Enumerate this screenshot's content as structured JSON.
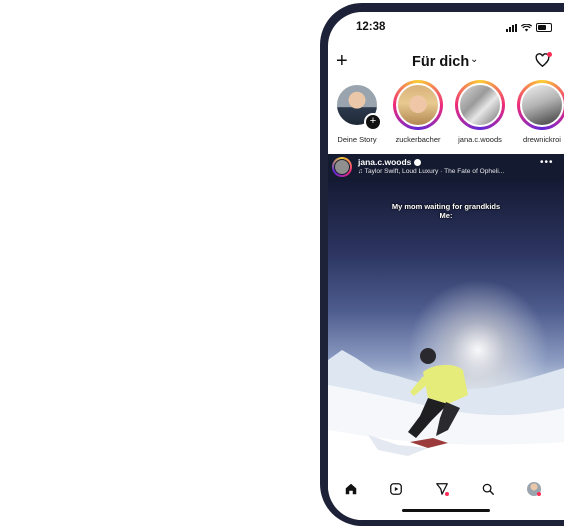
{
  "status_bar": {
    "time": "12:38"
  },
  "header": {
    "title": "Für dich",
    "chevron": "chevron-down-icon",
    "left_icon": "plus-icon",
    "right_icon": "heart-icon"
  },
  "stories": [
    {
      "label": "Deine Story",
      "ring": false
    },
    {
      "label": "zuckerbacher",
      "ring": true
    },
    {
      "label": "jana.c.woods",
      "ring": true
    },
    {
      "label": "drewnickroi",
      "ring": true
    }
  ],
  "post": {
    "username": "jana.c.woods",
    "music": "Taylor Swift, Loud Luxury · The Fate of Opheli...",
    "caption_line1": "My mom waiting for grandkids",
    "caption_line2": "Me:"
  },
  "nav": {
    "items": [
      "home-icon",
      "reels-icon",
      "direct-icon",
      "search-icon",
      "profile-avatar"
    ]
  },
  "colors": {
    "frame": "#1d2238",
    "accent_gradient_start": "#f9ce34",
    "accent_gradient_mid": "#ee2a7b",
    "notification_dot": "#ff2d55"
  }
}
